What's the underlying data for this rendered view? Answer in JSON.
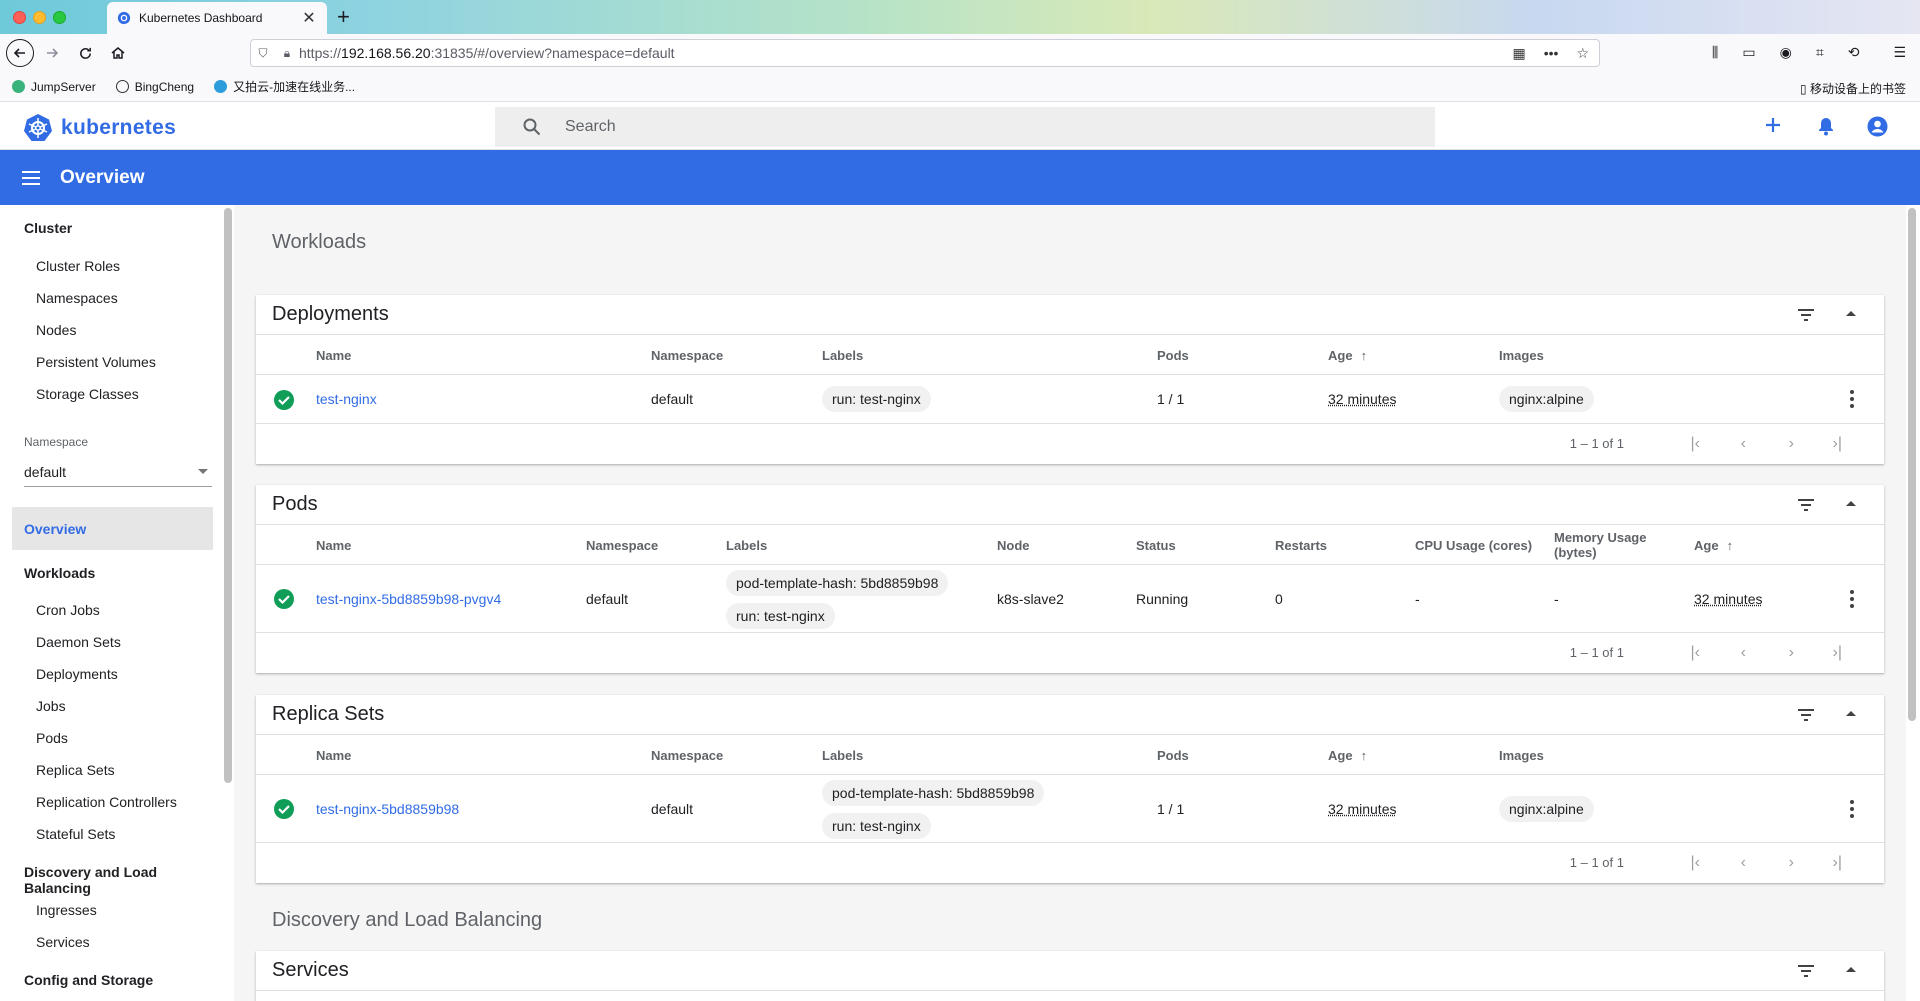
{
  "browser": {
    "tab_title": "Kubernetes Dashboard",
    "url_prefix": "https://",
    "url_host": "192.168.56.20",
    "url_rest": ":31835/#/overview?namespace=default",
    "bookmarks": [
      "JumpServer",
      "BingCheng",
      "又拍云-加速在线业务..."
    ],
    "mobile_bookmarks": "移动设备上的书签"
  },
  "header": {
    "brand": "kubernetes",
    "search_placeholder": "Search"
  },
  "toolbar": {
    "title": "Overview"
  },
  "sidebar": {
    "cluster_label": "Cluster",
    "cluster_items": [
      "Cluster Roles",
      "Namespaces",
      "Nodes",
      "Persistent Volumes",
      "Storage Classes"
    ],
    "namespace_label": "Namespace",
    "namespace_value": "default",
    "overview_label": "Overview",
    "workloads_label": "Workloads",
    "workloads_items": [
      "Cron Jobs",
      "Daemon Sets",
      "Deployments",
      "Jobs",
      "Pods",
      "Replica Sets",
      "Replication Controllers",
      "Stateful Sets"
    ],
    "discovery_label": "Discovery and Load Balancing",
    "discovery_items": [
      "Ingresses",
      "Services"
    ],
    "config_label": "Config and Storage"
  },
  "main": {
    "workloads_title": "Workloads",
    "discovery_title": "Discovery and Load Balancing",
    "deployments": {
      "title": "Deployments",
      "columns": [
        "Name",
        "Namespace",
        "Labels",
        "Pods",
        "Age",
        "Images"
      ],
      "row": {
        "name": "test-nginx",
        "namespace": "default",
        "labels": [
          "run: test-nginx"
        ],
        "pods": "1 / 1",
        "age": "32 minutes",
        "images": "nginx:alpine"
      },
      "pager": "1 – 1 of 1"
    },
    "pods": {
      "title": "Pods",
      "columns": [
        "Name",
        "Namespace",
        "Labels",
        "Node",
        "Status",
        "Restarts",
        "CPU Usage (cores)",
        "Memory Usage",
        "(bytes)",
        "Age"
      ],
      "row": {
        "name": "test-nginx-5bd8859b98-pvgv4",
        "namespace": "default",
        "labels": [
          "pod-template-hash: 5bd8859b98",
          "run: test-nginx"
        ],
        "node": "k8s-slave2",
        "status": "Running",
        "restarts": "0",
        "cpu": "-",
        "memory": "-",
        "age": "32 minutes"
      },
      "pager": "1 – 1 of 1"
    },
    "replicasets": {
      "title": "Replica Sets",
      "columns": [
        "Name",
        "Namespace",
        "Labels",
        "Pods",
        "Age",
        "Images"
      ],
      "row": {
        "name": "test-nginx-5bd8859b98",
        "namespace": "default",
        "labels": [
          "pod-template-hash: 5bd8859b98",
          "run: test-nginx"
        ],
        "pods": "1 / 1",
        "age": "32 minutes",
        "images": "nginx:alpine"
      },
      "pager": "1 – 1 of 1"
    },
    "services": {
      "title": "Services"
    }
  },
  "colors": {
    "brand": "#326ce5",
    "ok": "#0f9d58"
  }
}
